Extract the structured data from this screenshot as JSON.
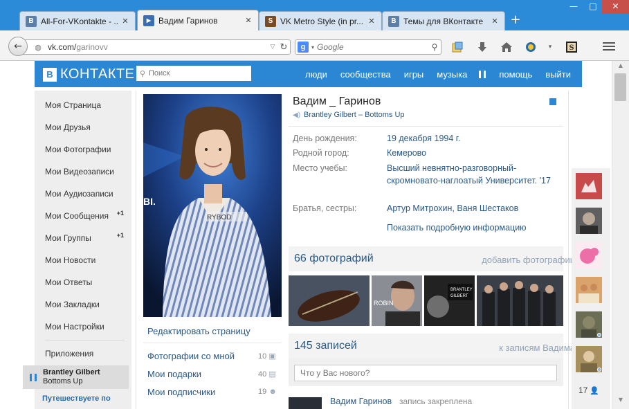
{
  "browser": {
    "tabs": [
      {
        "label": "All-For-VKontakte - ...",
        "favicon": "vk-favicon",
        "favicon_text": "B",
        "color": "#5b7fa6"
      },
      {
        "label": "Вадим Гаринов",
        "favicon": "play-favicon",
        "favicon_text": "▶",
        "color": "#3b6fb0",
        "active": true
      },
      {
        "label": "VK Metro Style (in pr...",
        "favicon": "s-favicon",
        "favicon_text": "S",
        "color": "#7a4a20"
      },
      {
        "label": "Темы для ВКонтакте",
        "favicon": "vk-favicon",
        "favicon_text": "B",
        "color": "#5b7fa6"
      }
    ],
    "address": {
      "host": "vk.com/",
      "path": "garinovv"
    },
    "search_placeholder": "Google"
  },
  "vk": {
    "logo_text": "КОНТАКТЕ",
    "logo_letter": "B",
    "search_placeholder": "Поиск",
    "nav": [
      "люди",
      "сообщества",
      "игры",
      "музыка",
      "помощь",
      "выйти"
    ],
    "accent": "#2b87d3"
  },
  "sidebar": {
    "items": [
      {
        "label": "Моя Страница",
        "badge": ""
      },
      {
        "label": "Мои Друзья",
        "badge": ""
      },
      {
        "label": "Мои Фотографии",
        "badge": ""
      },
      {
        "label": "Мои Видеозаписи",
        "badge": ""
      },
      {
        "label": "Мои Аудиозаписи",
        "badge": ""
      },
      {
        "label": "Мои Сообщения",
        "badge": "+1"
      },
      {
        "label": "Мои Группы",
        "badge": "+1"
      },
      {
        "label": "Мои Новости",
        "badge": ""
      },
      {
        "label": "Мои Ответы",
        "badge": ""
      },
      {
        "label": "Мои Закладки",
        "badge": ""
      },
      {
        "label": "Мои Настройки",
        "badge": ""
      }
    ],
    "apps_label": "Приложения",
    "player": {
      "artist": "Brantley Gilbert",
      "song": "Bottoms Up"
    },
    "travel": "Путешествуете по"
  },
  "profile": {
    "name": "Вадим _ Гаринов",
    "status": "Brantley Gilbert – Bottoms Up",
    "info": [
      {
        "label": "День рождения:",
        "value": "19 декабря 1994 г."
      },
      {
        "label": "Родной город:",
        "value": "Кемерово"
      },
      {
        "label": "Место учебы:",
        "value": "Высший невнятно-разговорный-скромновато-наглоатый Университет. '17"
      },
      {
        "label": "Братья, сестры:",
        "value": "Артур Митрохин, Ваня Шестаков"
      }
    ],
    "show_more": "Показать подробную информацию",
    "edit_page": "Редактировать страницу",
    "left_links": [
      {
        "label": "Фотографии со мной",
        "count": "10"
      },
      {
        "label": "Мои подарки",
        "count": "40"
      },
      {
        "label": "Мои подписчики",
        "count": "19"
      }
    ],
    "photo_shirt_text": "RYBOD",
    "photo_bg_text": "BI."
  },
  "photos_section": {
    "title": "66 фотографий",
    "action": "добавить фотографии",
    "thumb_text": "ROBIN",
    "thumb_text2": "BRANTLEY\nGILBERT"
  },
  "wall": {
    "title": "145 записей",
    "action": "к записям Вадима",
    "composer_placeholder": "Что у Вас нового?",
    "post_author": "Вадим Гаринов",
    "post_note": "запись закреплена"
  },
  "friends": {
    "count": "17"
  }
}
